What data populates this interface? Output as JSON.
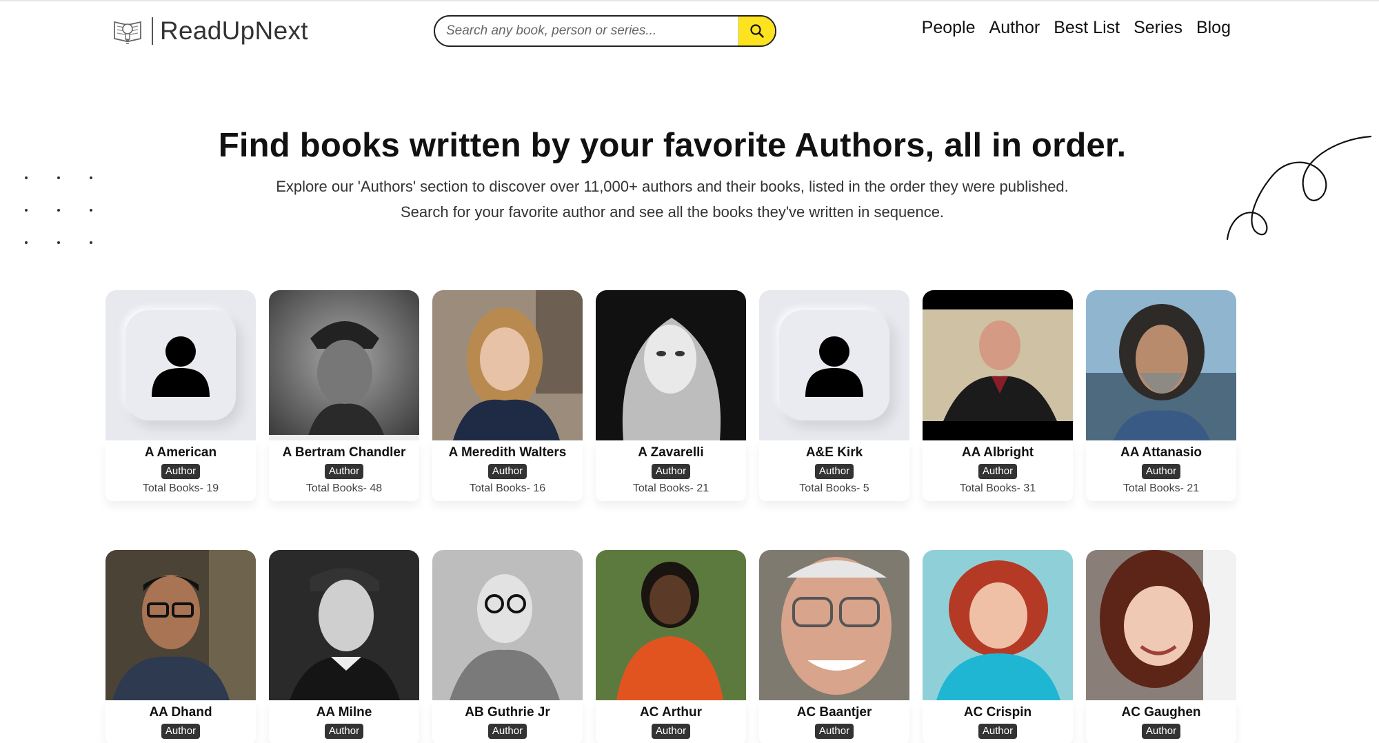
{
  "brand": {
    "name": "ReadUpNext"
  },
  "search": {
    "placeholder": "Search any book, person or series..."
  },
  "nav": [
    "People",
    "Author",
    "Best List",
    "Series",
    "Blog"
  ],
  "hero": {
    "title": "Find books written by your favorite Authors, all in order.",
    "line1": "Explore our 'Authors' section to discover over 11,000+ authors and their books, listed in the order they were published.",
    "line2": "Search for your favorite author and see all the books they've written in sequence."
  },
  "authors": [
    {
      "name": "A American",
      "badge": "Author",
      "count": "Total Books- 19",
      "photo": "placeholder"
    },
    {
      "name": "A Bertram Chandler",
      "badge": "Author",
      "count": "Total Books- 48",
      "photo": "sketch"
    },
    {
      "name": "A Meredith Walters",
      "badge": "Author",
      "count": "Total Books- 16",
      "photo": "woman-street"
    },
    {
      "name": "A Zavarelli",
      "badge": "Author",
      "count": "Total Books- 21",
      "photo": "bw-art"
    },
    {
      "name": "A&E Kirk",
      "badge": "Author",
      "count": "Total Books- 5",
      "photo": "placeholder"
    },
    {
      "name": "AA Albright",
      "badge": "Author",
      "count": "Total Books- 31",
      "photo": "man-tux"
    },
    {
      "name": "AA Attanasio",
      "badge": "Author",
      "count": "Total Books- 21",
      "photo": "man-beard"
    },
    {
      "name": "AA Dhand",
      "badge": "Author",
      "count": "",
      "photo": "man-glasses"
    },
    {
      "name": "AA Milne",
      "badge": "Author",
      "count": "",
      "photo": "bw-portrait"
    },
    {
      "name": "AB Guthrie Jr",
      "badge": "Author",
      "count": "",
      "photo": "bw-glasses"
    },
    {
      "name": "AC Arthur",
      "badge": "Author",
      "count": "",
      "photo": "woman-orange"
    },
    {
      "name": "AC Baantjer",
      "badge": "Author",
      "count": "",
      "photo": "old-man"
    },
    {
      "name": "AC Crispin",
      "badge": "Author",
      "count": "",
      "photo": "woman-red"
    },
    {
      "name": "AC Gaughen",
      "badge": "Author",
      "count": "",
      "photo": "woman-dark"
    }
  ]
}
